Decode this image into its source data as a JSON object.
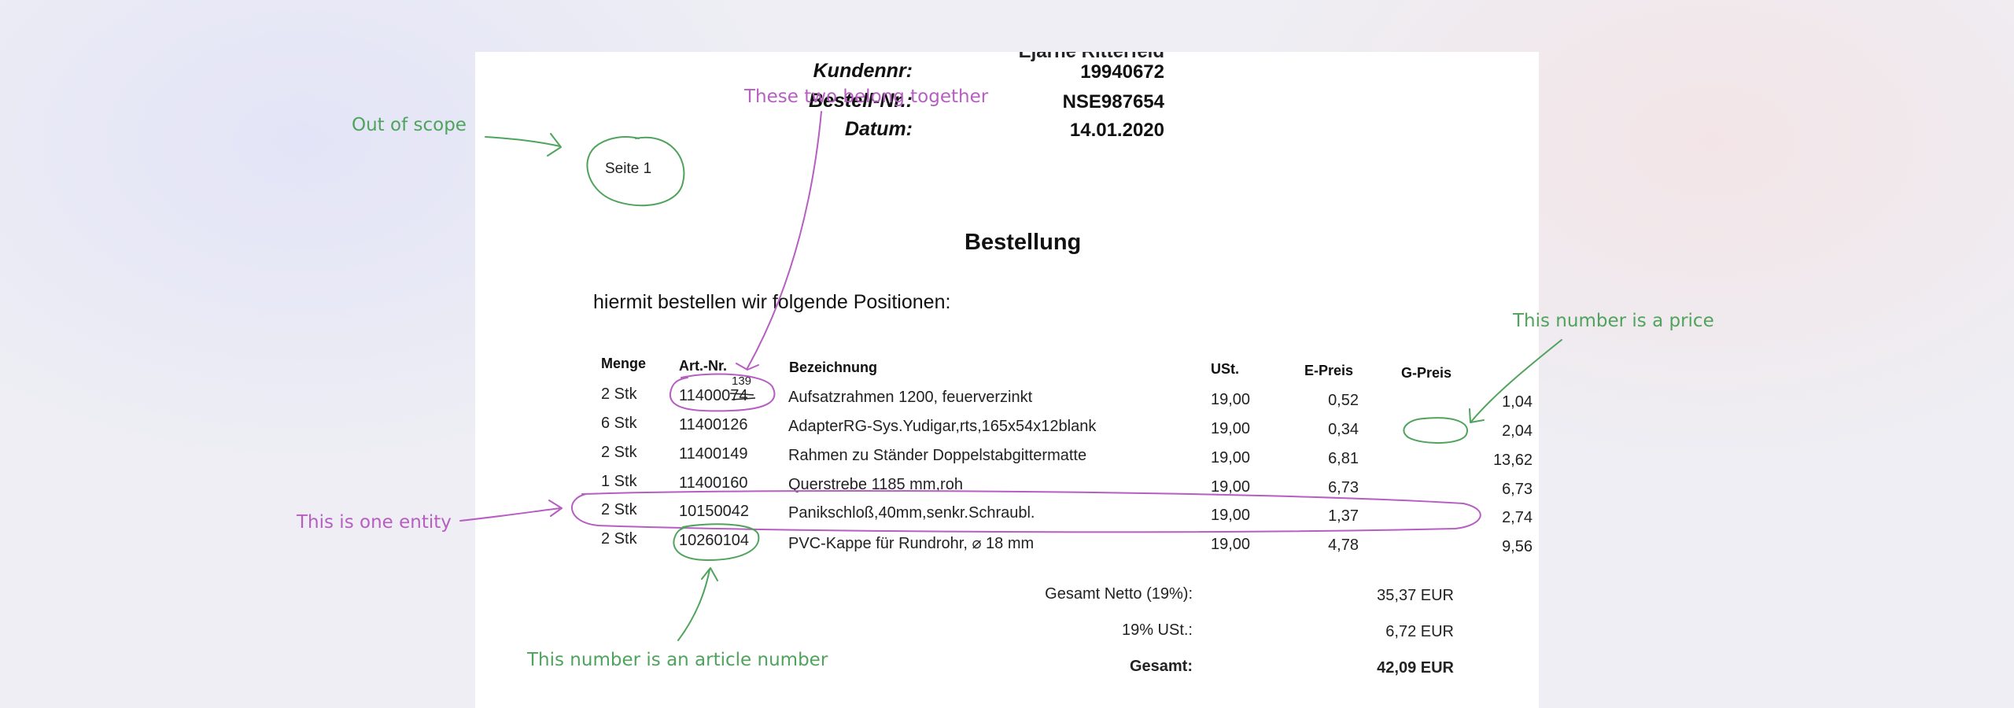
{
  "header": {
    "cut_text": "Ejarne Ritterfeld",
    "rows": [
      {
        "label": "Kundennr:",
        "value": "19940672"
      },
      {
        "label": "Bestell-Nr.:",
        "value": "NSE987654"
      },
      {
        "label": "Datum:",
        "value": "14.01.2020"
      }
    ]
  },
  "page_label": "Seite 1",
  "title": "Bestellung",
  "intro": "hiermit bestellen wir folgende Positionen:",
  "table": {
    "headers": {
      "menge": "Menge",
      "art": "Art.-Nr.",
      "bez": "Bezeichnung",
      "ust": "USt.",
      "epreis": "E-Preis",
      "gpreis": "G-Preis"
    },
    "rows": [
      {
        "menge": "2 Stk",
        "art": "11400074",
        "bez": "Aufsatzrahmen 1200, feuerverzinkt",
        "ust": "19,00",
        "epreis": "0,52",
        "gpreis": "1,04"
      },
      {
        "menge": "6 Stk",
        "art": "11400126",
        "bez": "AdapterRG-Sys.Yudigar,rts,165x54x12blank",
        "ust": "19,00",
        "epreis": "0,34",
        "gpreis": "2,04"
      },
      {
        "menge": "2 Stk",
        "art": "11400149",
        "bez": "Rahmen zu Ständer Doppelstabgittermatte",
        "ust": "19,00",
        "epreis": "6,81",
        "gpreis": "13,62"
      },
      {
        "menge": "1 Stk",
        "art": "11400160",
        "bez": "Querstrebe 1185 mm,roh",
        "ust": "19,00",
        "epreis": "6,73",
        "gpreis": "6,73"
      },
      {
        "menge": "2 Stk",
        "art": "10150042",
        "bez": "Panikschloß,40mm,senkr.Schraubl.",
        "ust": "19,00",
        "epreis": "1,37",
        "gpreis": "2,74"
      },
      {
        "menge": "2 Stk",
        "art": "10260104",
        "bez": "PVC-Kappe für Rundrohr, ⌀ 18 mm",
        "ust": "19,00",
        "epreis": "4,78",
        "gpreis": "9,56"
      }
    ]
  },
  "correction": "139",
  "totals": [
    {
      "label": "Gesamt Netto (19%):",
      "value": "35,37 EUR"
    },
    {
      "label": "19% USt.:",
      "value": "6,72 EUR"
    },
    {
      "label": "Gesamt:",
      "value": "42,09 EUR"
    }
  ],
  "annotations": {
    "out_of_scope": "Out of scope",
    "belong_together": "These two belong together",
    "price": "This number is a price",
    "one_entity": "This is one entity",
    "article_number": "This number is an article number"
  },
  "colors": {
    "green": "#4fa35c",
    "purple": "#b65ec2"
  }
}
